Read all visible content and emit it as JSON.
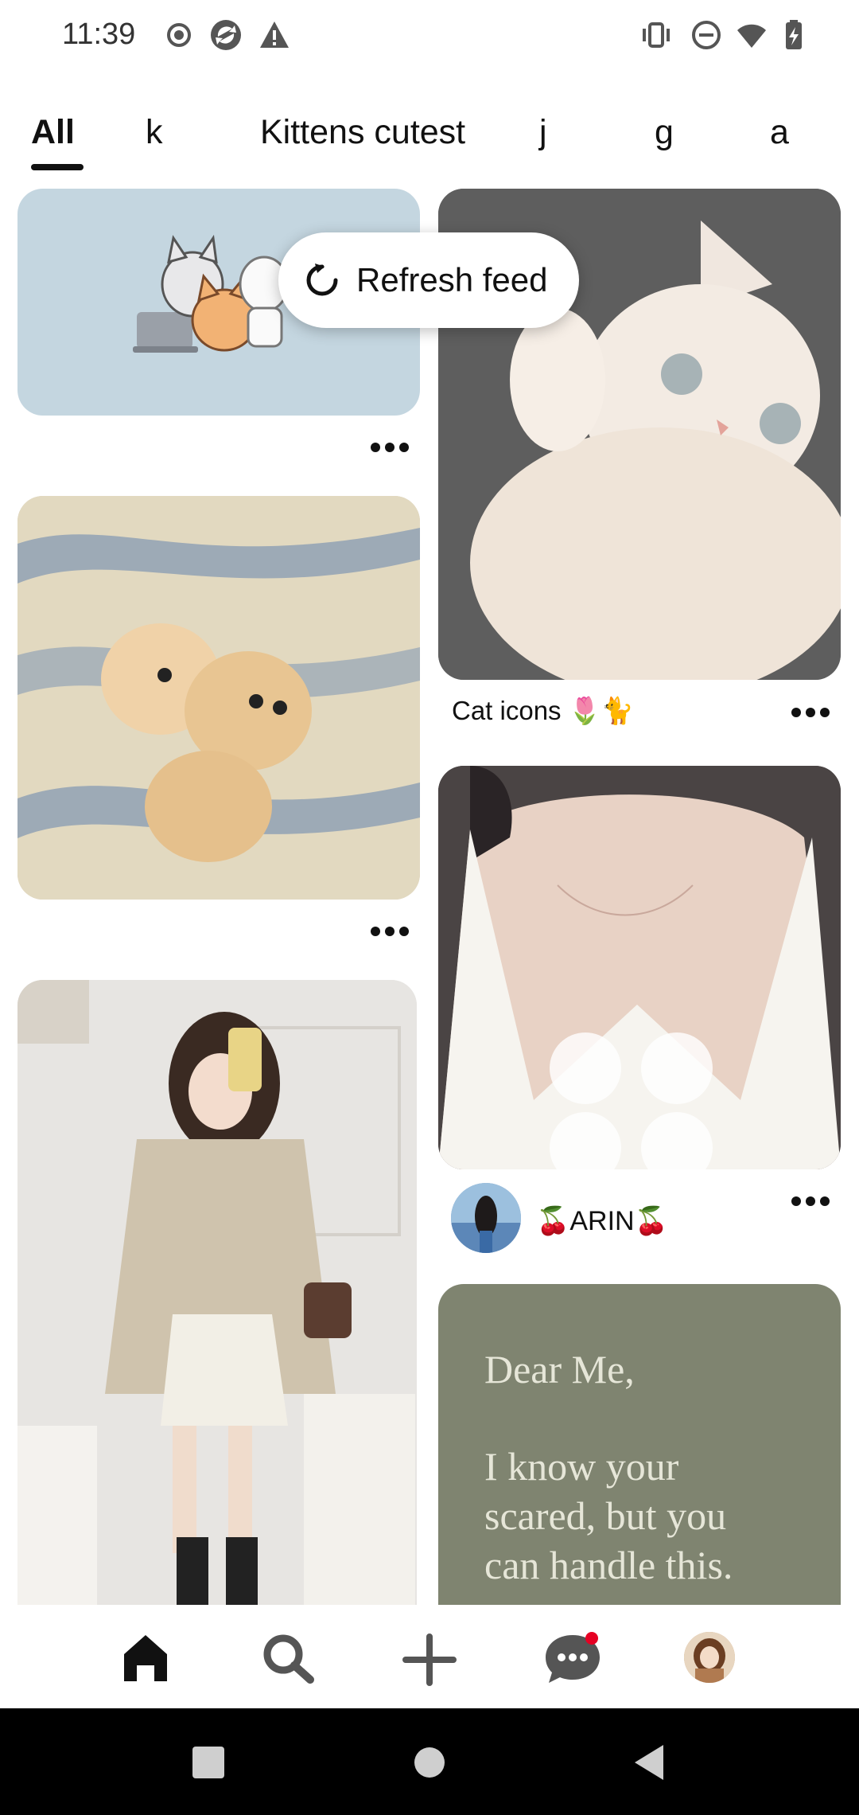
{
  "status_bar": {
    "time": "11:39",
    "left_icons": [
      "record-icon",
      "sync-app-icon",
      "warning-icon"
    ],
    "right_icons": [
      "vibrate-icon",
      "do-not-disturb-icon",
      "wifi-icon",
      "battery-charging-icon"
    ]
  },
  "tabs": [
    {
      "label": "All",
      "active": true
    },
    {
      "label": "k",
      "active": false
    },
    {
      "label": "Kittens cutest",
      "active": false
    },
    {
      "label": "j",
      "active": false
    },
    {
      "label": "g",
      "active": false
    },
    {
      "label": "a",
      "active": false
    }
  ],
  "refresh": {
    "label": "Refresh feed",
    "icon": "refresh-icon"
  },
  "pins": {
    "cartoon_cats": {
      "description_icon": "cartoon-cats-image"
    },
    "white_kitten": {
      "title": "Cat icons 🌷🐈"
    },
    "two_kittens": {},
    "girl_outfit": {},
    "white_top": {
      "author": "🍒ARIN🍒"
    },
    "dear_me": {
      "line1": "Dear Me,",
      "line2": "I know your",
      "line3": "scared, but you",
      "line4": "can handle this."
    }
  },
  "bottom_nav": {
    "items": [
      "home-icon",
      "search-icon",
      "create-icon",
      "messages-icon",
      "profile-avatar"
    ],
    "messages_badge_color": "#e60023"
  },
  "colors": {
    "cartoon_card_bg": "#c4d6e0",
    "dear_me_bg": "#7f8470",
    "dear_me_text": "#e6e6d8"
  }
}
